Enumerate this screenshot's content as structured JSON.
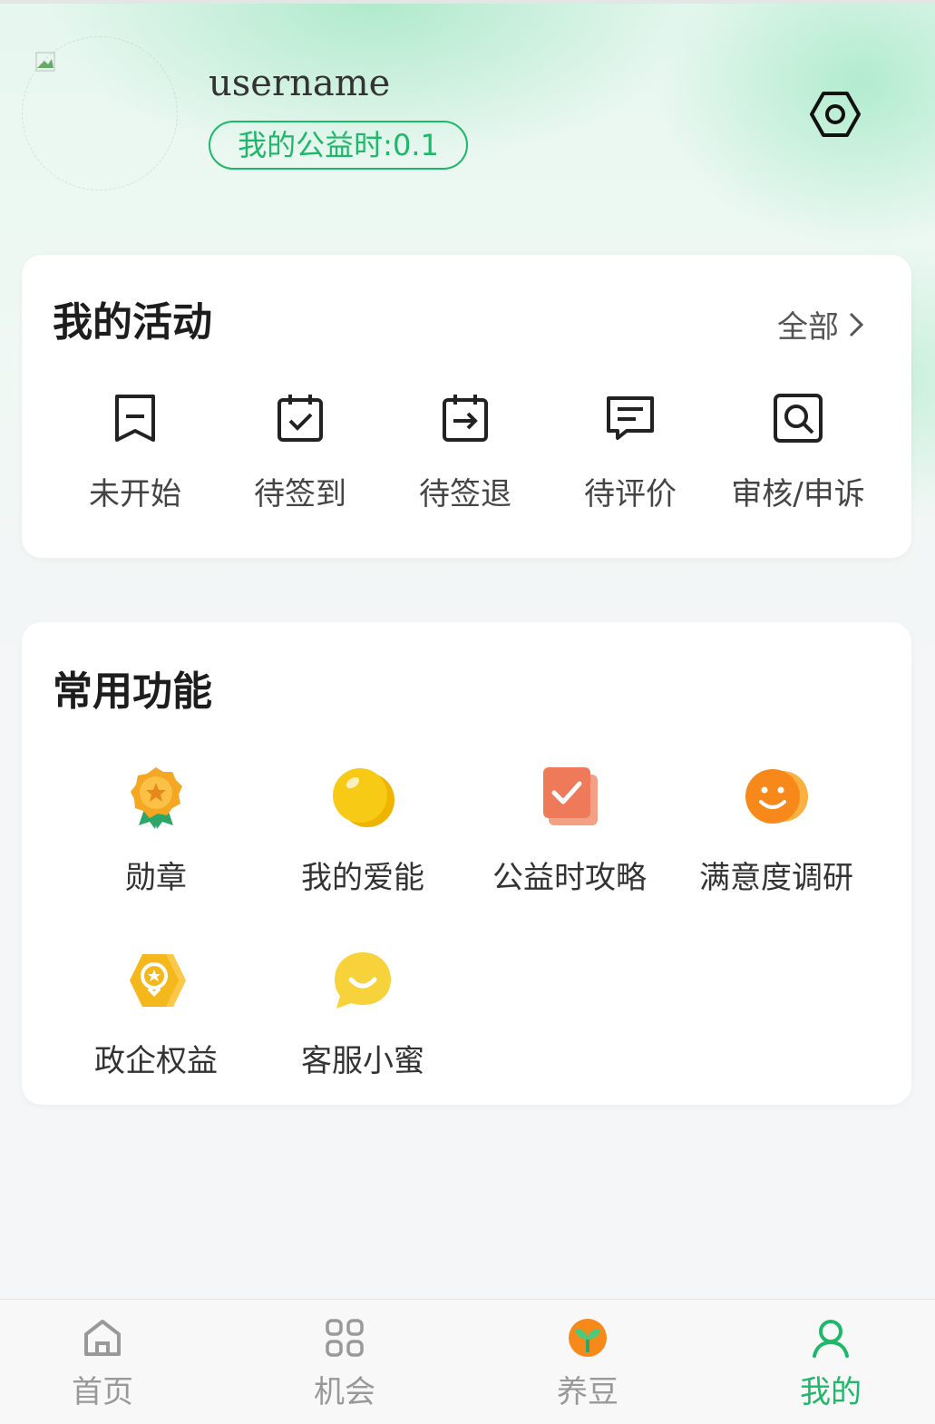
{
  "profile": {
    "username": "username",
    "hours_badge": "我的公益时:0.1"
  },
  "activities": {
    "title": "我的活动",
    "all_label": "全部",
    "items": [
      {
        "label": "未开始",
        "icon": "bookmark-minus-icon"
      },
      {
        "label": "待签到",
        "icon": "calendar-check-icon"
      },
      {
        "label": "待签退",
        "icon": "calendar-exit-icon"
      },
      {
        "label": "待评价",
        "icon": "comment-icon"
      },
      {
        "label": "审核/申诉",
        "icon": "review-search-icon"
      }
    ]
  },
  "functions": {
    "title": "常用功能",
    "items": [
      {
        "label": "勋章",
        "icon": "medal-icon",
        "color": "#f5a623"
      },
      {
        "label": "我的爱能",
        "icon": "energy-orb-icon",
        "color": "#f5c518"
      },
      {
        "label": "公益时攻略",
        "icon": "checklist-icon",
        "color": "#ef7a5a"
      },
      {
        "label": "满意度调研",
        "icon": "smile-icon",
        "color": "#f7891b"
      },
      {
        "label": "政企权益",
        "icon": "badge-hexagon-icon",
        "color": "#f5b81c"
      },
      {
        "label": "客服小蜜",
        "icon": "chat-smile-icon",
        "color": "#f7d23b"
      }
    ]
  },
  "tabbar": {
    "items": [
      {
        "label": "首页",
        "icon": "home-icon"
      },
      {
        "label": "机会",
        "icon": "grid-icon"
      },
      {
        "label": "养豆",
        "icon": "sprout-icon"
      },
      {
        "label": "我的",
        "icon": "user-icon",
        "active": true
      }
    ],
    "active_color": "#1eb86a"
  }
}
